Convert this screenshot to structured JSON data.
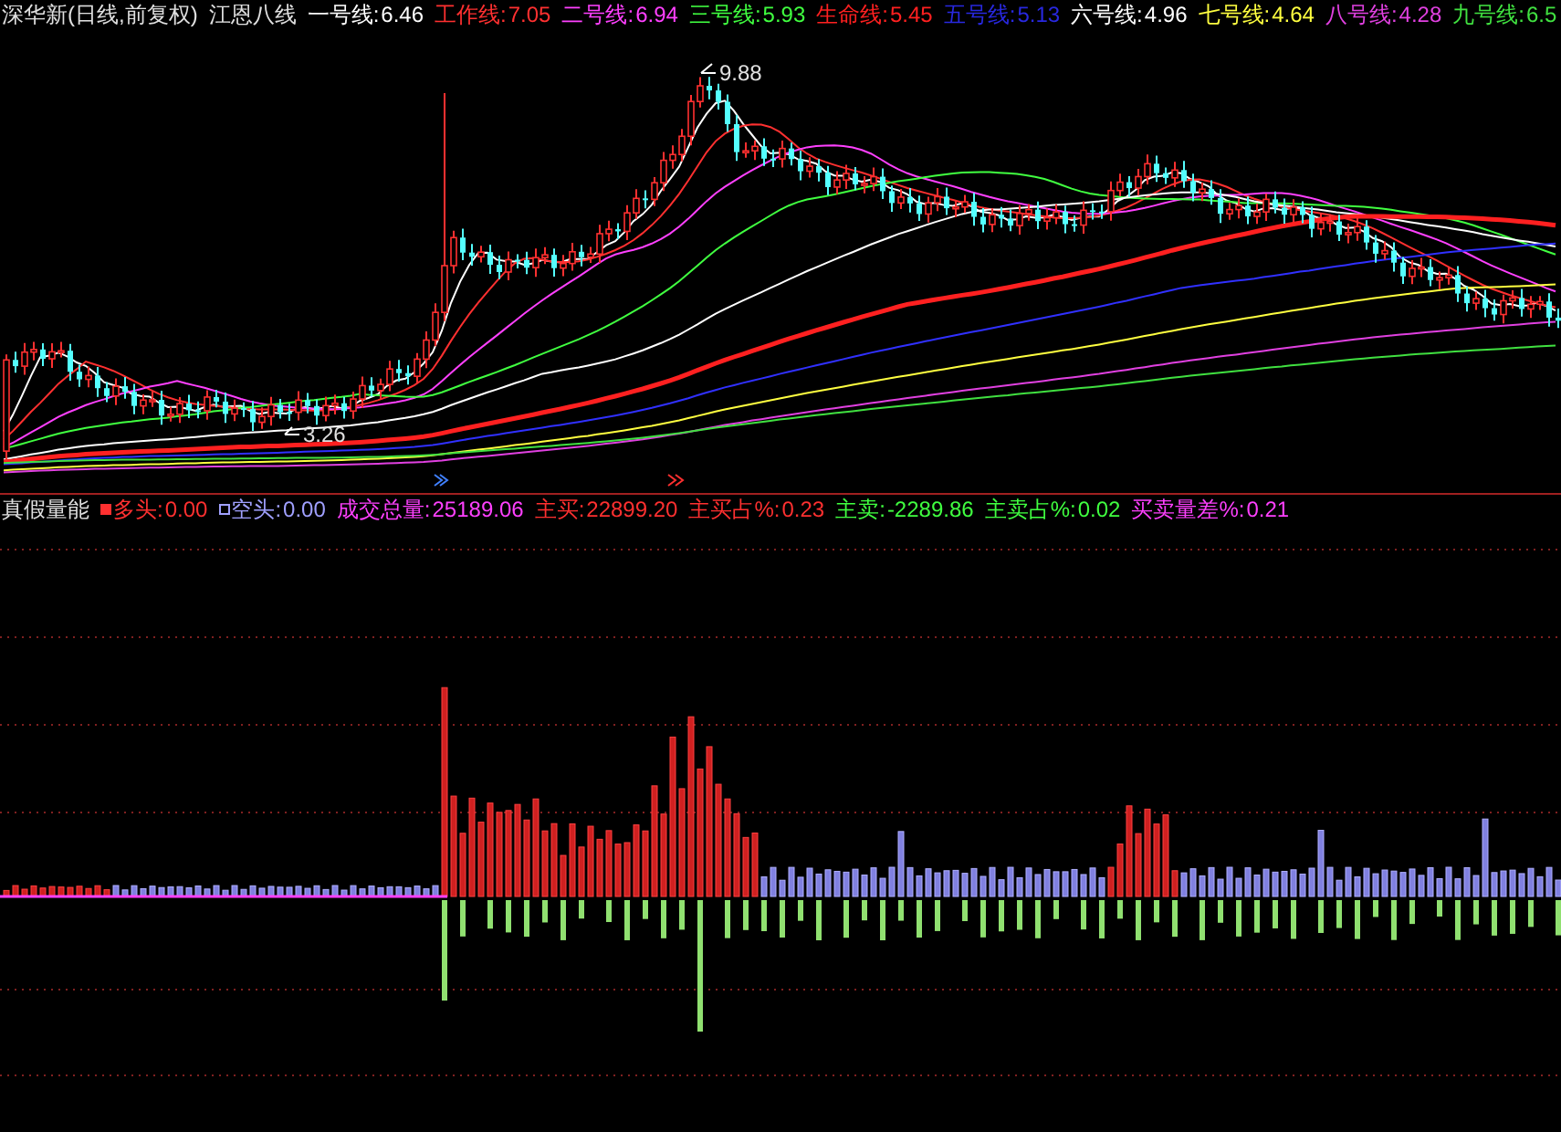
{
  "price_panel": {
    "title": "深华新(日线,前复权)",
    "indicator": "江恩八线",
    "legend": [
      {
        "label": "一号线:",
        "value": "6.46",
        "color": "#ffffff"
      },
      {
        "label": "工作线:",
        "value": "7.05",
        "color": "#ff3030"
      },
      {
        "label": "二号线:",
        "value": "6.94",
        "color": "#ff40ff"
      },
      {
        "label": "三号线:",
        "value": "5.93",
        "color": "#40ff40"
      },
      {
        "label": "生命线:",
        "value": "5.45",
        "color": "#ff2020"
      },
      {
        "label": "五号线:",
        "value": "5.13",
        "color": "#2828e0"
      },
      {
        "label": "六号线:",
        "value": "4.96",
        "color": "#ffffff"
      },
      {
        "label": "七号线:",
        "value": "4.64",
        "color": "#ffff40"
      },
      {
        "label": "八号线:",
        "value": "4.28",
        "color": "#e040e0"
      },
      {
        "label": "九号线:",
        "value": "6.5",
        "color": "#40e040"
      }
    ],
    "high_label": "9.88",
    "low_label": "3.26"
  },
  "volume_panel": {
    "title": "真假量能",
    "legend": [
      {
        "kind": "filled",
        "label": "多头:",
        "value": "0.00",
        "color": "#ff3030"
      },
      {
        "kind": "hollow",
        "label": "空头:",
        "value": "0.00",
        "color": "#a0a0ff"
      },
      {
        "kind": "none",
        "label": "成交总量:",
        "value": "25189.06",
        "color": "#ff40ff"
      },
      {
        "kind": "none",
        "label": "主买:",
        "value": "22899.20",
        "color": "#ff3030"
      },
      {
        "kind": "none",
        "label": "主买占%:",
        "value": "0.23",
        "color": "#ff3030"
      },
      {
        "kind": "none",
        "label": "主卖:",
        "value": "-2289.86",
        "color": "#40ff40"
      },
      {
        "kind": "none",
        "label": "主卖占%:",
        "value": "0.02",
        "color": "#40ff40"
      },
      {
        "kind": "none",
        "label": "买卖量差%:",
        "value": "0.21",
        "color": "#ff40ff"
      }
    ]
  }
}
